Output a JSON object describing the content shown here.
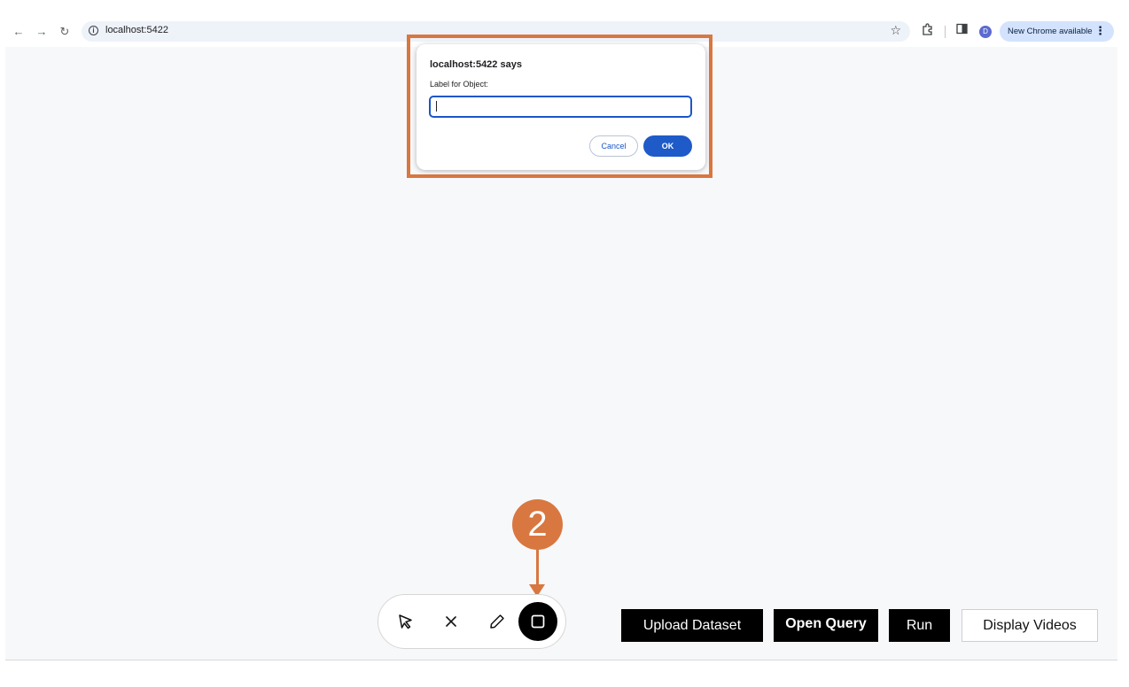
{
  "browser": {
    "url": "localhost:5422",
    "avatar_initial": "D",
    "update_pill": "New Chrome available",
    "nav": {
      "back": "←",
      "forward": "→",
      "reload": "↻"
    }
  },
  "dialog": {
    "title": "localhost:5422 says",
    "message": "Label for Object:",
    "input_value": "",
    "cancel_label": "Cancel",
    "ok_label": "OK"
  },
  "annotation": {
    "step_number": "2",
    "color": "#d97740"
  },
  "toolbar": {
    "tools": [
      {
        "name": "select",
        "icon": "cursor-icon"
      },
      {
        "name": "delete",
        "icon": "close-icon"
      },
      {
        "name": "draw",
        "icon": "pencil-icon"
      },
      {
        "name": "rectangle",
        "icon": "square-icon",
        "active": true
      }
    ]
  },
  "actions": {
    "upload_dataset": "Upload Dataset",
    "open_query": "Open Query",
    "run": "Run",
    "display_videos": "Display Videos"
  }
}
